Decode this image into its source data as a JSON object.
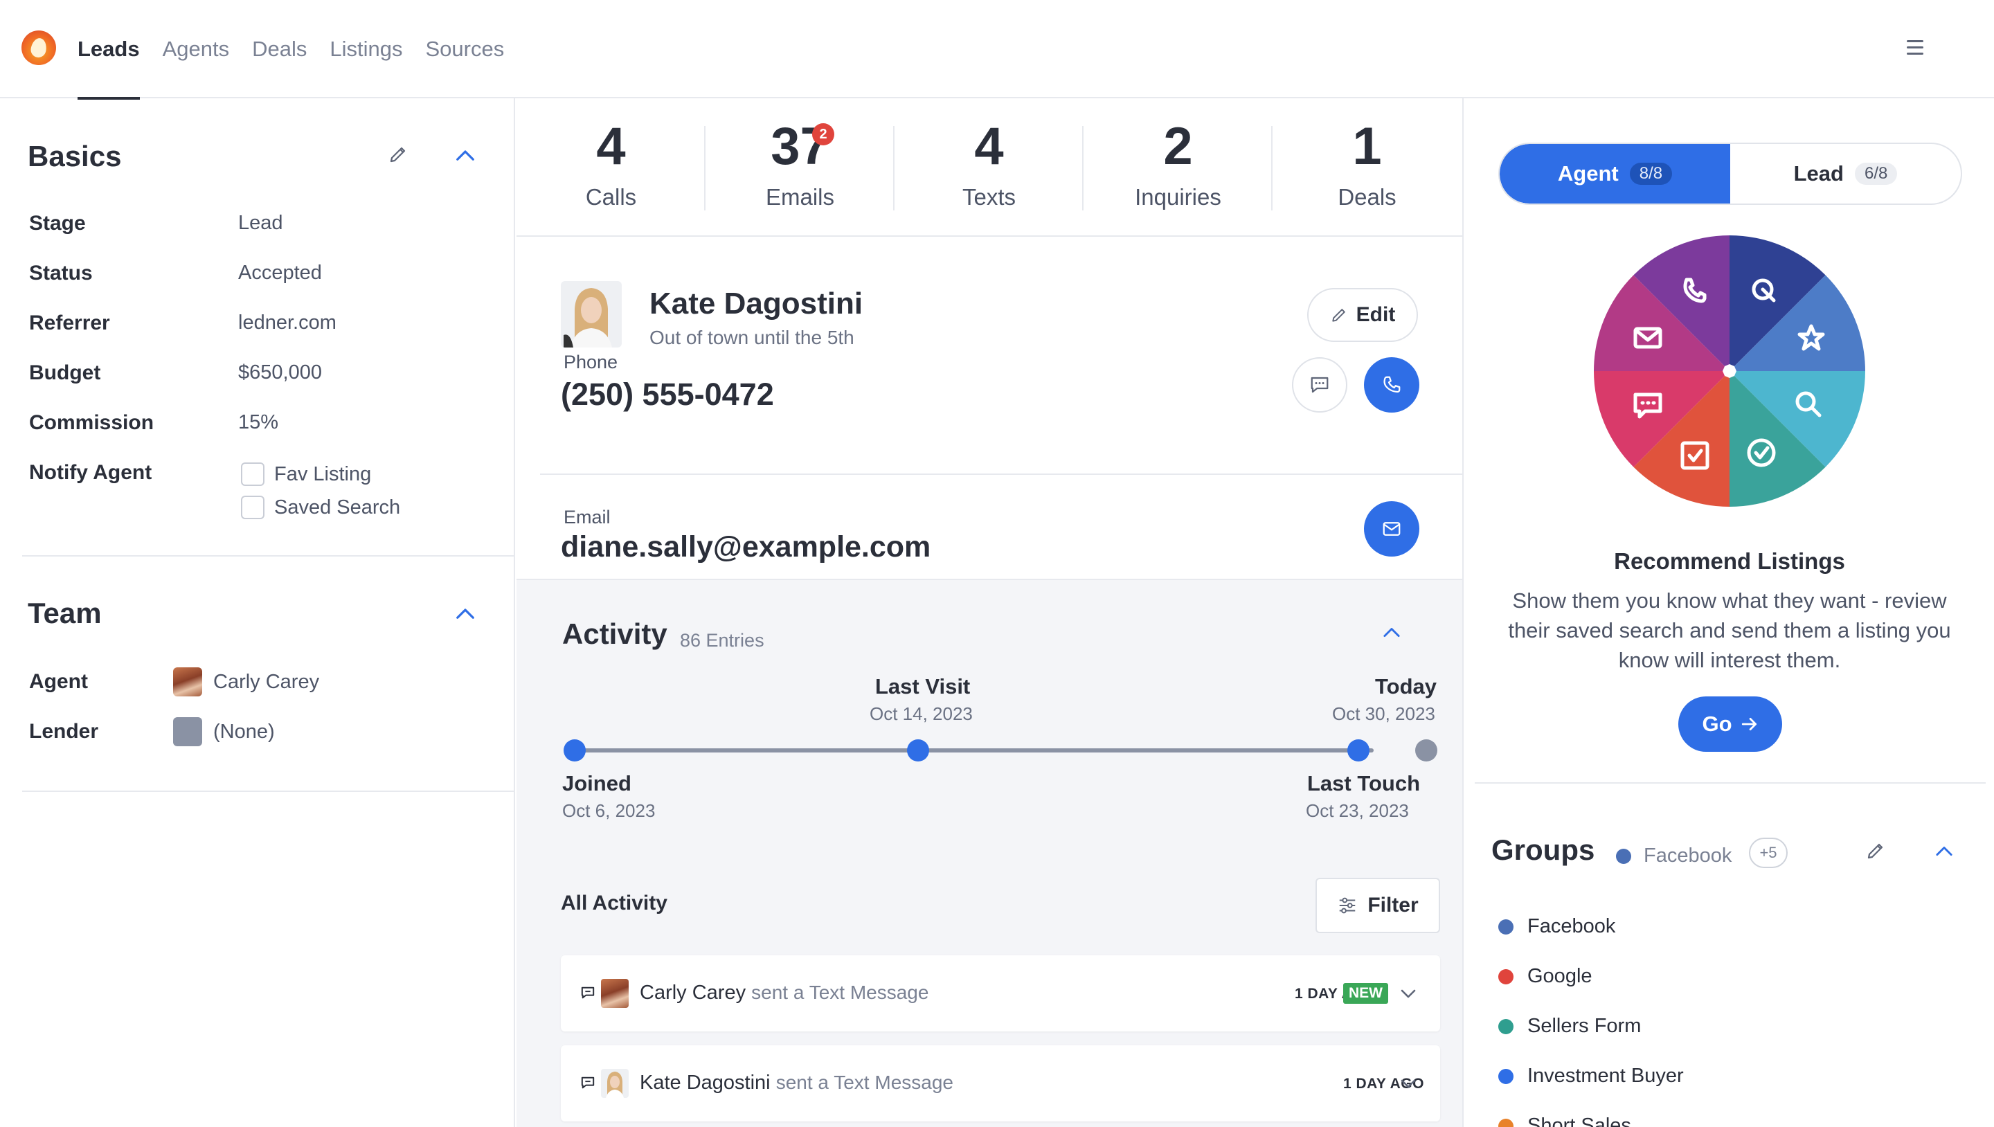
{
  "nav": {
    "items": [
      "Leads",
      "Agents",
      "Deals",
      "Listings",
      "Sources"
    ],
    "active": "Leads"
  },
  "basics": {
    "title": "Basics",
    "fields": [
      {
        "label": "Stage",
        "value": "Lead"
      },
      {
        "label": "Status",
        "value": "Accepted"
      },
      {
        "label": "Referrer",
        "value": "ledner.com"
      },
      {
        "label": "Budget",
        "value": "$650,000"
      },
      {
        "label": "Commission",
        "value": "15%"
      }
    ],
    "notify_label": "Notify Agent",
    "notify_options": [
      "Fav Listing",
      "Saved Search"
    ]
  },
  "team": {
    "title": "Team",
    "agent_label": "Agent",
    "agent_value": "Carly Carey",
    "lender_label": "Lender",
    "lender_value": "(None)"
  },
  "stats": [
    {
      "value": "4",
      "label": "Calls"
    },
    {
      "value": "37",
      "label": "Emails",
      "badge": "2"
    },
    {
      "value": "4",
      "label": "Texts"
    },
    {
      "value": "2",
      "label": "Inquiries"
    },
    {
      "value": "1",
      "label": "Deals"
    }
  ],
  "contact": {
    "name": "Kate Dagostini",
    "subtitle": "Out of town until the 5th",
    "edit_label": "Edit",
    "phone_label": "Phone",
    "phone": "(250) 555-0472",
    "email_label": "Email",
    "email": "diane.sally@example.com"
  },
  "activity": {
    "title": "Activity",
    "entries": "86 Entries",
    "timeline": {
      "joined": {
        "label": "Joined",
        "date": "Oct 6, 2023"
      },
      "last_visit": {
        "label": "Last Visit",
        "date": "Oct 14, 2023"
      },
      "last_touch": {
        "label": "Last Touch",
        "date": "Oct 23, 2023"
      },
      "today": {
        "label": "Today",
        "date": "Oct 30, 2023"
      }
    },
    "all_label": "All Activity",
    "filter_label": "Filter",
    "rows": [
      {
        "who": "Carly Carey",
        "what": "sent a Text Message",
        "when": "1 DAY AGO",
        "badge": "NEW"
      },
      {
        "who": "Kate Dagostini",
        "what": "sent a Text Message",
        "when": "1 DAY AGO"
      }
    ]
  },
  "right": {
    "toggle": {
      "agent": "Agent",
      "agent_count": "8/8",
      "lead": "Lead",
      "lead_count": "6/8"
    },
    "rec_title": "Recommend Listings",
    "rec_body": "Show them you know what they want - review their saved search and send them a listing you know will interest them.",
    "go_label": "Go",
    "groups_title": "Groups",
    "groups_inline": "Facebook",
    "groups_more": "+5",
    "groups": [
      {
        "name": "Facebook",
        "color": "#4a6fb5"
      },
      {
        "name": "Google",
        "color": "#e0443c"
      },
      {
        "name": "Sellers Form",
        "color": "#2f9e8f"
      },
      {
        "name": "Investment Buyer",
        "color": "#2f6ee6"
      },
      {
        "name": "Short Sales",
        "color": "#e8822a"
      }
    ]
  },
  "colors": {
    "accent": "#2f6ee6",
    "badge_red": "#e0443c",
    "badge_green": "#3aa757"
  }
}
